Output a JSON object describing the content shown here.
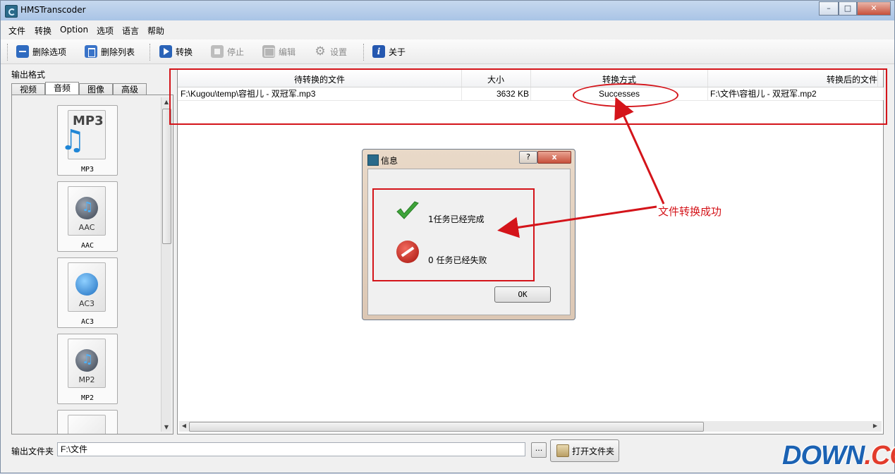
{
  "window": {
    "title": "HMSTranscoder"
  },
  "menu": [
    "文件",
    "转换",
    "Option",
    "选项",
    "语言",
    "帮助"
  ],
  "toolbar": {
    "remove_selected": "删除选项",
    "remove_list": "删除列表",
    "convert": "转换",
    "stop": "停止",
    "edit": "编辑",
    "settings": "设置",
    "about": "关于"
  },
  "left_panel": {
    "label": "输出格式",
    "tabs": [
      "视频",
      "音频",
      "图像",
      "高级"
    ],
    "active_tab": "音频",
    "formats": [
      {
        "label": "MP3",
        "icon_text": "MP3"
      },
      {
        "label": "AAC",
        "icon_text": "AAC"
      },
      {
        "label": "AC3",
        "icon_text": "AC3"
      },
      {
        "label": "MP2",
        "icon_text": "MP2"
      }
    ]
  },
  "table": {
    "columns": [
      "待转换的文件",
      "大小",
      "转换方式",
      "转换后的文件"
    ],
    "rows": [
      {
        "source": "F:\\Kugou\\temp\\容祖儿 - 双冠军.mp3",
        "size": "3632 KB",
        "method": "Successes",
        "target": "F:\\文件\\容祖儿 - 双冠军.mp2"
      }
    ]
  },
  "dialog": {
    "title": "信息",
    "help": "?",
    "close": "x",
    "completed": "1任务已经完成",
    "failed": "0 任务已经失败",
    "ok": "OK"
  },
  "annotation": "文件转换成功",
  "bottom": {
    "label": "输出文件夹",
    "path": "F:\\文件",
    "browse": "...",
    "open_folder": "打开文件夹"
  },
  "watermark": {
    "main": "DOWN",
    "suffix": ".CC"
  },
  "colors": {
    "annotation_red": "#d4141a",
    "accent_blue": "#2a63b8"
  }
}
